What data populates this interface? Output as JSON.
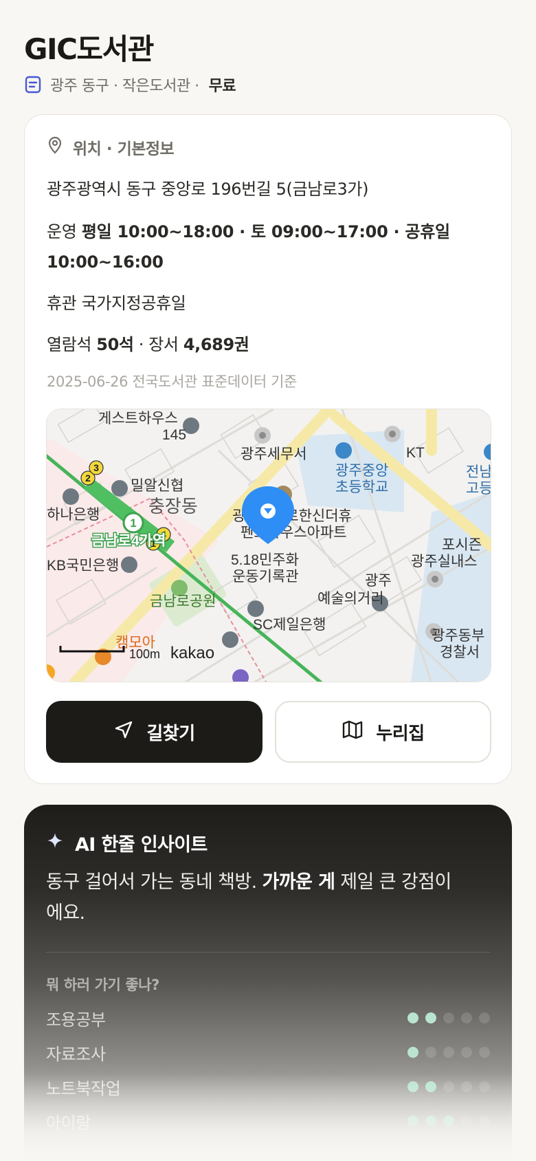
{
  "header": {
    "title": "GIC도서관",
    "meta": "광주 동구 · 작은도서관 ·",
    "fee": "무료"
  },
  "info_card": {
    "heading": "위치 · 기본정보",
    "address": "광주광역시 동구 중앙로 196번길 5(금남로3가)",
    "hours_label": "운영",
    "hours_value": "평일 10:00~18:00 · 토 09:00~17:00 · 공휴일 10:00~16:00",
    "closed_label": "휴관",
    "closed_value": "국가지정공휴일",
    "seats_label": "열람석",
    "seats_value": "50석",
    "books_label": "· 장서",
    "books_value": "4,689권",
    "source": "2025-06-26 전국도서관 표준데이터 기준"
  },
  "map": {
    "labels": {
      "guesthouse": "게스트하우스",
      "guesthouse_no": "145",
      "tax_office": "광주세무서",
      "kt": "KT",
      "school1": "광주중앙",
      "school2": "초등학교",
      "school_edge1": "전남",
      "school_edge2": "고등",
      "milal": "밀알신협",
      "chungjang": "충장동",
      "hana": "하나은행",
      "station": "금남로4가역",
      "kb": "KB국민은행",
      "apt1": "광주금남로한신더휴",
      "apt2": "펜트하우스아파트",
      "memorial1": "5.18민주화",
      "memorial2": "운동기록관",
      "park": "금남로공원",
      "art1": "광주",
      "art2": "예술의거리",
      "porsche1": "포시즌",
      "porsche2": "광주실내스",
      "sc": "SC제일은행",
      "police1": "광주동부",
      "police2": "경찰서",
      "campoa": "캠모아",
      "scale": "100m",
      "brand": "kakao",
      "line_num": "1",
      "exit1": "1",
      "exit2": "2",
      "exit3": "3",
      "exit4": "4"
    }
  },
  "actions": {
    "directions": "길찾기",
    "homepage": "누리집"
  },
  "ai_insight": {
    "title": "AI 한줄 인사이트",
    "text_pre": "동구 걸어서 가는 동네 책방. ",
    "text_bold": "가까운 게",
    "text_post": " 제일 큰 강점이에요.",
    "subtitle": "뭐 하러 가기 좋나?",
    "rows": [
      {
        "label": "조용공부",
        "score": 2,
        "max": 5
      },
      {
        "label": "자료조사",
        "score": 1,
        "max": 5
      },
      {
        "label": "노트북작업",
        "score": 2,
        "max": 5
      },
      {
        "label": "아이랑",
        "score": 3,
        "max": 5
      }
    ],
    "accent": "#b9e4cf"
  }
}
